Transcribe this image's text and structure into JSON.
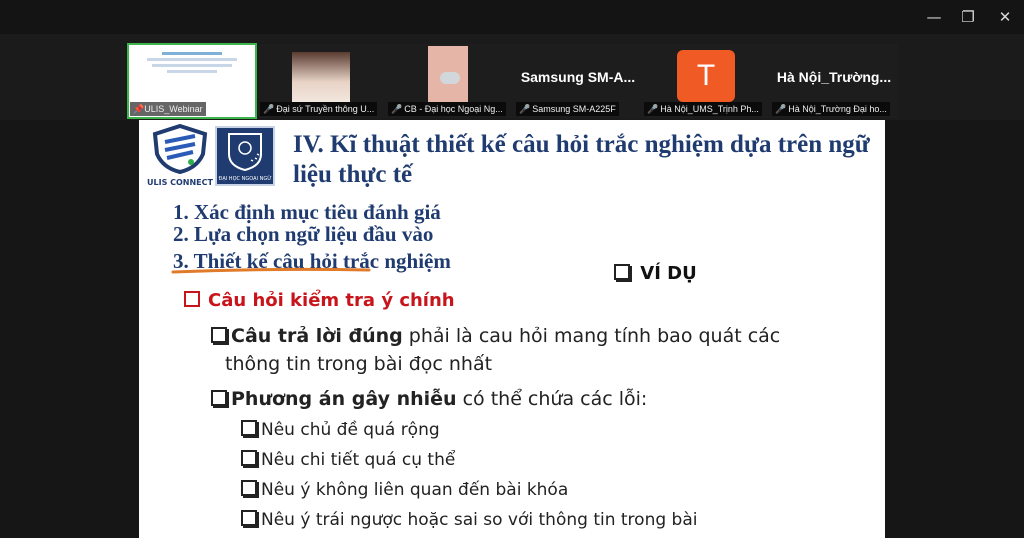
{
  "window": {
    "minimize": "—",
    "restore": "❐",
    "close": "✕"
  },
  "participants": [
    {
      "label": "ULIS_Webinar",
      "kind": "slide-thumb",
      "active": true
    },
    {
      "label": "Đại sứ Truyền thông U...",
      "kind": "video",
      "muted": true
    },
    {
      "label": "CB - Đại học Ngoại Ng...",
      "kind": "video",
      "muted": true
    },
    {
      "label": "Samsung SM-A225F",
      "name": "Samsung SM-A...",
      "kind": "name",
      "muted": true
    },
    {
      "label": "Hà Nội_UMS_Trịnh Ph...",
      "avatar": "T",
      "kind": "avatar",
      "muted": true
    },
    {
      "label": "Hà Nội_Trường Đại ho...",
      "name": "Hà Nội_Trường...",
      "kind": "name",
      "muted": true
    }
  ],
  "slide": {
    "logo_text": "ULIS CONNECT",
    "logo2_text": "ĐẠI HỌC NGOẠI NGỮ",
    "title": "IV. Kĩ thuật thiết kế câu hỏi trắc nghiệm dựa trên ngữ liệu thực tế",
    "steps": [
      "1. Xác định mục tiêu đánh giá",
      "2. Lựa chọn ngữ liệu đầu vào",
      "3. Thiết kế câu hỏi trắc nghiệm"
    ],
    "example": "VÍ DỤ",
    "section": "Câu hỏi kiểm tra ý chính",
    "correct_bold": "Câu trả lời đúng",
    "correct_rest": " phải là cau hỏi mang tính bao quát các",
    "correct_line2": "thông tin trong bài đọc nhất",
    "distractor_bold": "Phương án gây nhiễu",
    "distractor_rest": " có thể chứa các lỗi:",
    "errors": [
      "Nêu chủ đề quá rộng",
      "Nêu chi tiết quá cụ thể",
      "Nêu ý không liên quan đến bài khóa",
      "Nêu ý trái ngược hoặc sai so với thông tin trong bài"
    ],
    "colors": {
      "title": "#1f3b70",
      "section": "#c8151b",
      "underline": "#e07b2b"
    }
  }
}
